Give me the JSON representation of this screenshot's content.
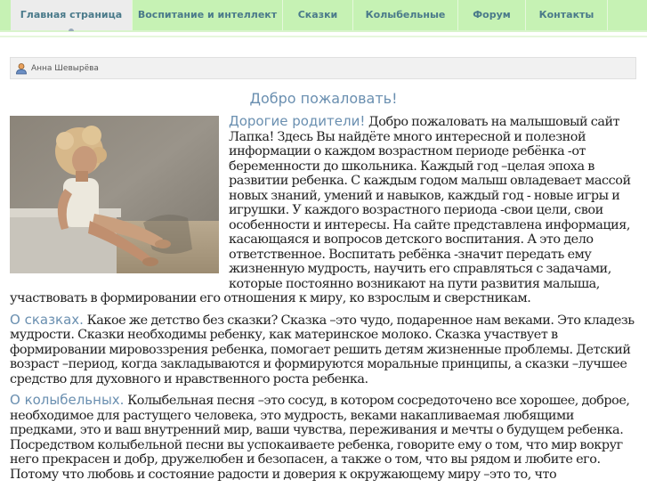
{
  "nav": {
    "items": [
      {
        "label": "Главная страница",
        "active": true
      },
      {
        "label": "Воспитание и интеллект"
      },
      {
        "label": "Сказки"
      },
      {
        "label": "Колыбельные"
      },
      {
        "label": "Форум"
      },
      {
        "label": "Контакты"
      }
    ]
  },
  "author": {
    "name": "Анна Шевырёва",
    "icon": "user-icon"
  },
  "page": {
    "welcome": "Добро пожаловать!"
  },
  "article": {
    "p1_lead": "Дорогие родители!",
    "p1_text": " Добро пожаловать на малышовый сайт Лапка! Здесь Вы найдёте много интересной и полезной информации о каждом возрастном периоде ребёнка -от беременности до школьника. Каждый год –целая эпоха в развитии ребенка. С каждым годом малыш овладевает массой новых знаний, умений и навыков, каждый год - новые игры и игрушки. У каждого возрастного периода -свои цели, свои особенности и интересы. На сайте представлена информация, касающаяся и вопросов детского воспитания. А это дело ответственное. Воспитать ребёнка -значит передать ему жизненную мудрость, научить его справляться с задачами, которые постоянно возникают на пути развития малыша, участвовать в формировании его отношения к миру, ко взрослым и сверстникам.",
    "p2_lead": "О сказках.",
    "p2_text": " Какое же детство без сказки? Сказка –это чудо, подаренное нам веками. Это кладезь мудрости. Сказки необходимы ребенку, как материнское молоко. Сказка участвует в формировании мировоззрения ребенка, помогает решить детям жизненные проблемы. Детский возраст –период, когда закладываются и формируются моральные принципы, а сказки –лучшее средство для духовного и нравственного роста ребенка.",
    "p3_lead": "О колыбельных.",
    "p3_text": " Колыбельная песня –это сосуд, в котором сосредоточено все хорошее, доброе, необходимое для растущего человека, это мудрость, веками накапливаемая любящими предками, это и ваш внутренний мир, ваши чувства, переживания и мечты о будущем ребенка. Посредством колыбельной песни вы успокаиваете ребенка, говорите ему о том, что мир вокруг него прекрасен и добр, дружелюбен и безопасен, а также о том, что вы рядом и любите его. Потому что любовь и состояние радости и доверия к окружающему миру –это то, что"
  },
  "colors": {
    "nav_bg": "#c6f2b4",
    "accent": "#6a8fb0"
  }
}
